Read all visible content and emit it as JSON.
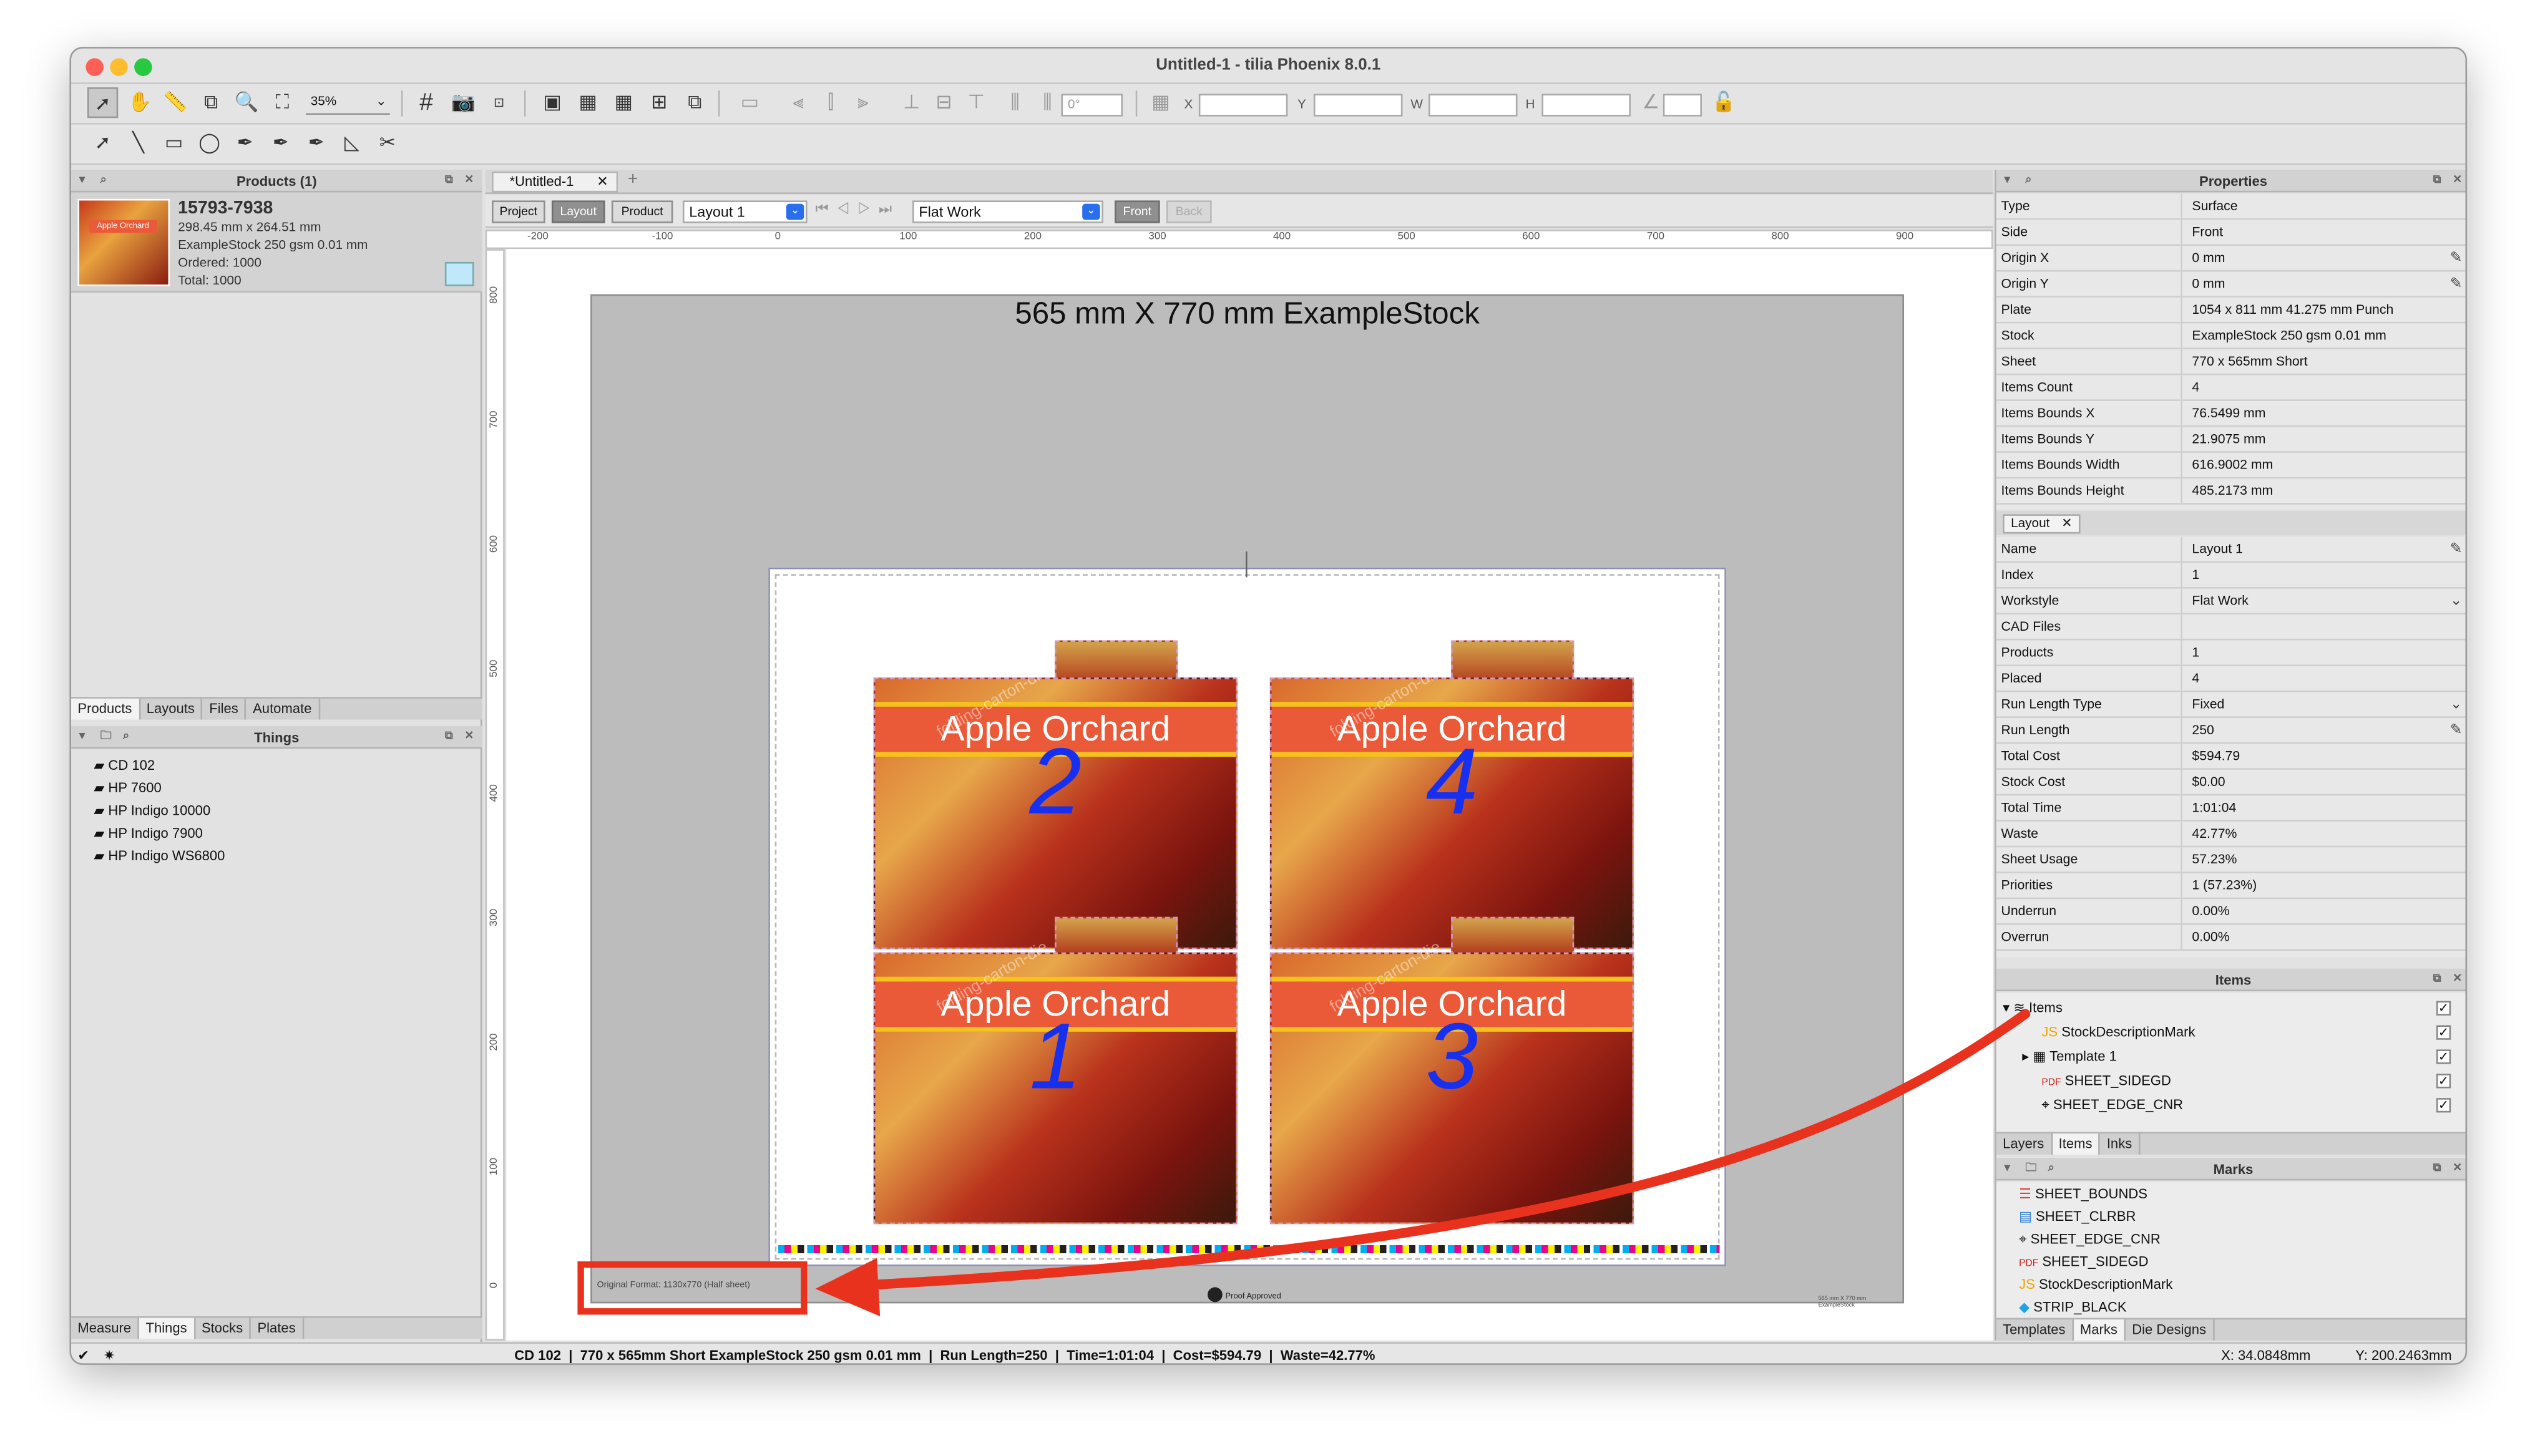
{
  "window": {
    "title": "Untitled-1 - tilia Phoenix 8.0.1"
  },
  "toolbar": {
    "zoom": "35%",
    "angle": "0°",
    "x_label": "X",
    "y_label": "Y",
    "w_label": "W",
    "h_label": "H"
  },
  "products_panel": {
    "title": "Products (1)",
    "product": {
      "id": "15793-7938",
      "size": "298.45 mm x 264.51 mm",
      "stock": "ExampleStock 250 gsm 0.01 mm",
      "ordered": "Ordered: 1000",
      "total": "Total: 1000",
      "thumb_label": "Apple Orchard"
    },
    "tabs": [
      "Products",
      "Layouts",
      "Files",
      "Automate"
    ]
  },
  "things_panel": {
    "title": "Things",
    "items": [
      "CD 102",
      "HP 7600",
      "HP Indigo 10000",
      "HP Indigo 7900",
      "HP Indigo WS6800"
    ],
    "tabs": [
      "Measure",
      "Things",
      "Stocks",
      "Plates"
    ]
  },
  "doc_tabs": [
    "*Untitled-1"
  ],
  "layout_bar": {
    "buttons": [
      "Project",
      "Layout",
      "Product"
    ],
    "layout_select": "Layout 1",
    "workstyle_select": "Flat Work",
    "side_buttons": [
      "Front",
      "Back"
    ]
  },
  "ruler": {
    "h_ticks": [
      "-200",
      "-100",
      "0",
      "100",
      "200",
      "300",
      "400",
      "500",
      "600",
      "700",
      "800",
      "900"
    ],
    "v_ticks": [
      "800",
      "700",
      "600",
      "500",
      "400",
      "300",
      "200",
      "100",
      "0"
    ]
  },
  "canvas": {
    "sheet_title": "565 mm X 770 mm ExampleStock",
    "items": [
      {
        "label": "Apple Orchard",
        "number": "2"
      },
      {
        "label": "Apple Orchard",
        "number": "4"
      },
      {
        "label": "Apple Orchard",
        "number": "1"
      },
      {
        "label": "Apple Orchard",
        "number": "3"
      }
    ],
    "watermark": "folding-carton-die",
    "original_format": "Original Format: 1130x770 (Half sheet)",
    "proof_text": "Proof Approved",
    "stock_note": "565 mm X 770 mm ExampleStock"
  },
  "properties": {
    "title": "Properties",
    "rows": [
      [
        "Type",
        "Surface"
      ],
      [
        "Side",
        "Front"
      ],
      [
        "Origin X",
        "0 mm"
      ],
      [
        "Origin Y",
        "0 mm"
      ],
      [
        "Plate",
        "1054 x 811 mm 41.275 mm Punch"
      ],
      [
        "Stock",
        "ExampleStock 250 gsm 0.01 mm"
      ],
      [
        "Sheet",
        "770 x 565mm Short"
      ],
      [
        "Items Count",
        "4"
      ],
      [
        "Items Bounds X",
        "76.5499 mm"
      ],
      [
        "Items Bounds Y",
        "21.9075 mm"
      ],
      [
        "Items Bounds Width",
        "616.9002 mm"
      ],
      [
        "Items Bounds Height",
        "485.2173 mm"
      ]
    ],
    "layout_tab": "Layout",
    "layout_rows": [
      [
        "Name",
        "Layout 1"
      ],
      [
        "Index",
        "1"
      ],
      [
        "Workstyle",
        "Flat Work"
      ],
      [
        "CAD Files",
        ""
      ],
      [
        "Products",
        "1"
      ],
      [
        "Placed",
        "4"
      ],
      [
        "Run Length Type",
        "Fixed"
      ],
      [
        "Run Length",
        "250"
      ],
      [
        "Total Cost",
        "$594.79"
      ],
      [
        "Stock Cost",
        "$0.00"
      ],
      [
        "Total Time",
        "1:01:04"
      ],
      [
        "Waste",
        "42.77%"
      ],
      [
        "Sheet Usage",
        "57.23%"
      ],
      [
        "Priorities",
        "1 (57.23%)"
      ],
      [
        "Underrun",
        "0.00%"
      ],
      [
        "Overrun",
        "0.00%"
      ]
    ]
  },
  "items_panel": {
    "title": "Items",
    "rows": [
      "Items",
      "StockDescriptionMark",
      "Template 1",
      "SHEET_SIDEGD",
      "SHEET_EDGE_CNR"
    ],
    "tabs": [
      "Layers",
      "Items",
      "Inks"
    ]
  },
  "marks_panel": {
    "title": "Marks",
    "rows": [
      "SHEET_BOUNDS",
      "SHEET_CLRBR",
      "SHEET_EDGE_CNR",
      "SHEET_SIDEGD",
      "StockDescriptionMark",
      "STRIP_BLACK"
    ],
    "tabs": [
      "Templates",
      "Marks",
      "Die Designs"
    ]
  },
  "status": {
    "center": "CD 102  |  770 x 565mm Short ExampleStock 250 gsm 0.01 mm  |  Run Length=250  |  Time=1:01:04  |  Cost=$594.79  |  Waste=42.77%",
    "x": "X: 34.0848mm",
    "y": "Y: 200.2463mm"
  },
  "colors": {
    "annotation": "#e8321e",
    "accent_blue": "#1730f0",
    "selection": "#2a6ef0"
  }
}
